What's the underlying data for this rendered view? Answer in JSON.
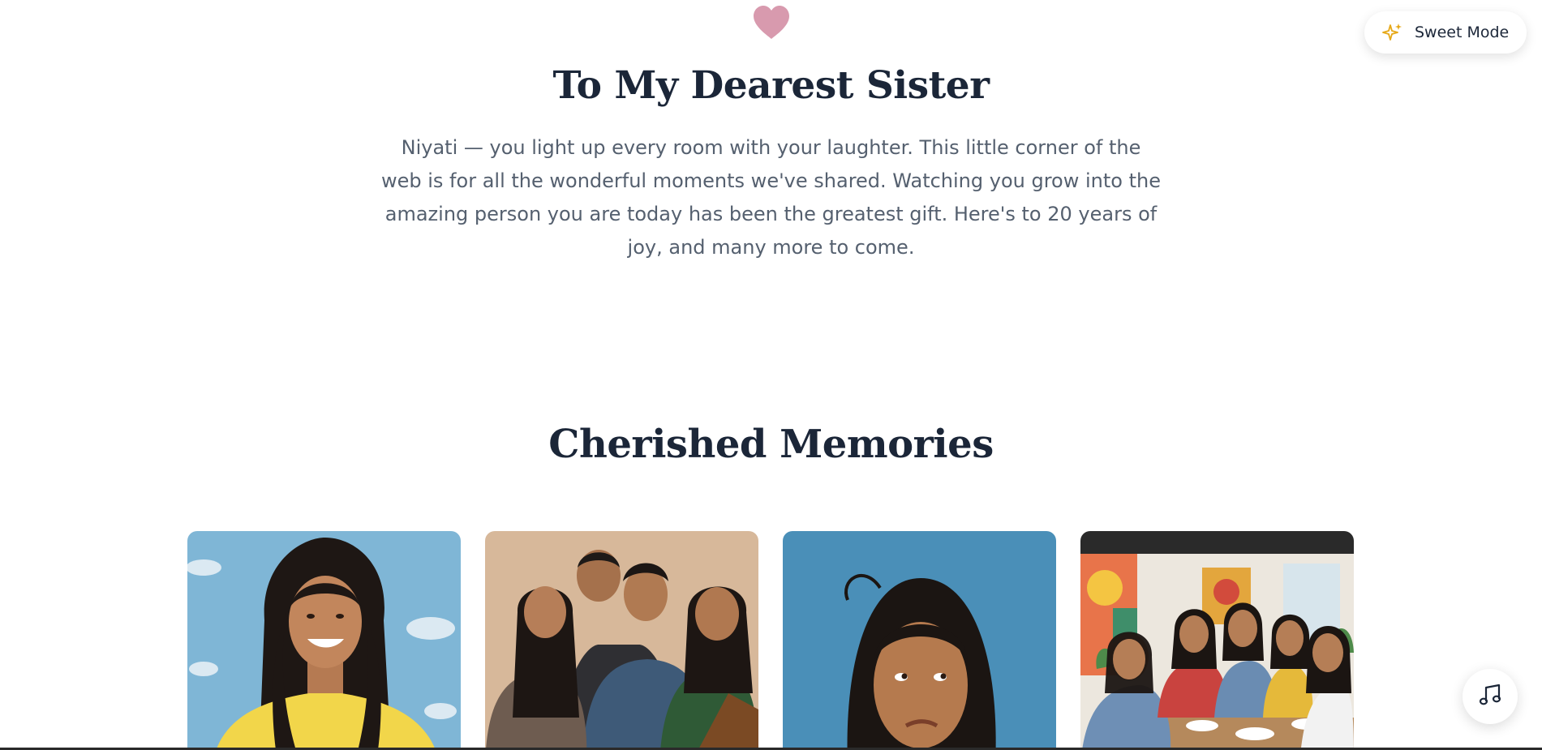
{
  "header": {
    "heart_icon": "heart-icon",
    "title": "To My Dearest Sister",
    "message": "Niyati — you light up every room with your laughter. This little corner of the web is for all the wonderful moments we've shared. Watching you grow into the amazing person you are today has been the greatest gift. Here's to 20 years of joy, and many more to come."
  },
  "memories": {
    "title": "Cherished Memories",
    "photos": [
      {
        "subject": "smiling-girl-yellow-shirt-photo"
      },
      {
        "subject": "family-portrait-photo"
      },
      {
        "subject": "thinking-girl-photo"
      },
      {
        "subject": "friends-at-cafe-photo"
      }
    ]
  },
  "controls": {
    "sweet_mode_label": "Sweet Mode",
    "sweet_mode_icon": "sparkles-icon",
    "music_icon": "music-note-icon"
  },
  "colors": {
    "heart": "#d89aae",
    "heading": "#1b2638",
    "body_text": "#55606f",
    "sparkle": "#e6a817"
  }
}
